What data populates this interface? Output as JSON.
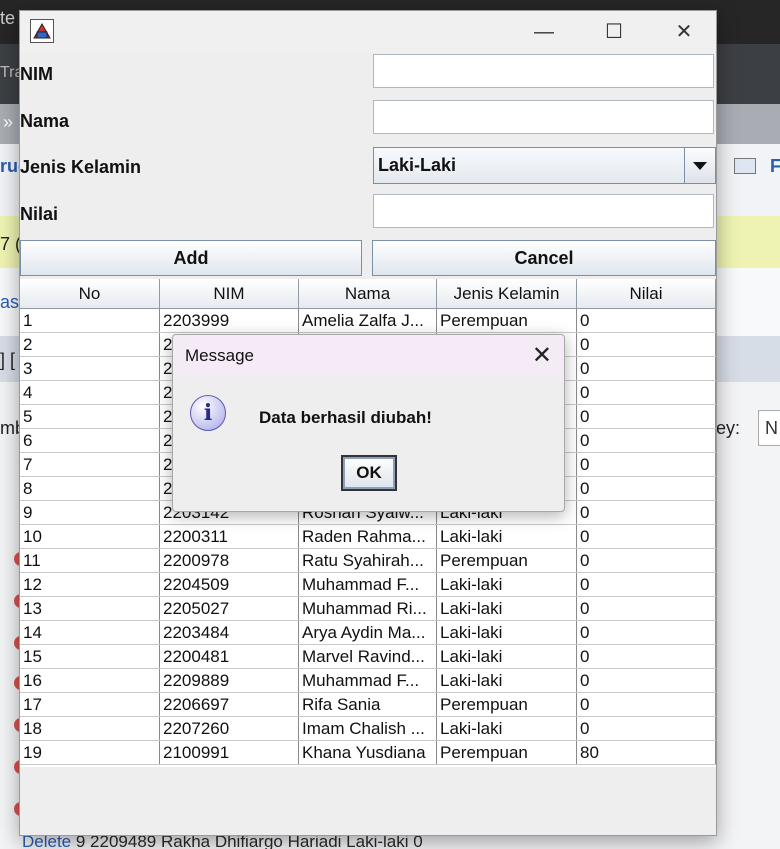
{
  "background": {
    "frag_te": "te",
    "frag_tra": "Tra",
    "frag_arrows": "»",
    "frag_uc": "ruc",
    "frag_f": "F",
    "frag_seven": "7 (",
    "frag_as": "as:",
    "frag_brackets": "] [",
    "frag_mb": "mb",
    "frag_ey": "ey:",
    "frag_n": "N",
    "row_text_delete": "Delete",
    "row_text_rest": "9     2209489  Rakha Dhifiargo Hariadi          Laki-laki          0"
  },
  "window": {
    "minimize": "—",
    "maximize": "☐",
    "close": "✕"
  },
  "form": {
    "nim_label": "NIM",
    "nama_label": "Nama",
    "jk_label": "Jenis Kelamin",
    "nilai_label": "Nilai",
    "jk_value": "Laki-Laki",
    "add_label": "Add",
    "cancel_label": "Cancel"
  },
  "table": {
    "headers": [
      "No",
      "NIM",
      "Nama",
      "Jenis Kelamin",
      "Nilai"
    ],
    "rows": [
      [
        "1",
        "2203999",
        "Amelia Zalfa J...",
        "Perempuan",
        "0"
      ],
      [
        "2",
        "2",
        "",
        "",
        "0"
      ],
      [
        "3",
        "2",
        "",
        "",
        "0"
      ],
      [
        "4",
        "2",
        "",
        "",
        "0"
      ],
      [
        "5",
        "2",
        "",
        "",
        "0"
      ],
      [
        "6",
        "2",
        "",
        "",
        "0"
      ],
      [
        "7",
        "2",
        "",
        "",
        "0"
      ],
      [
        "8",
        "2",
        "",
        "",
        "0"
      ],
      [
        "9",
        "2203142",
        "Roshan Syalw...",
        "Laki-laki",
        "0"
      ],
      [
        "10",
        "2200311",
        "Raden Rahma...",
        "Laki-laki",
        "0"
      ],
      [
        "11",
        "2200978",
        "Ratu Syahirah...",
        "Perempuan",
        "0"
      ],
      [
        "12",
        "2204509",
        "Muhammad F...",
        "Laki-laki",
        "0"
      ],
      [
        "13",
        "2205027",
        "Muhammad Ri...",
        "Laki-laki",
        "0"
      ],
      [
        "14",
        "2203484",
        "Arya Aydin Ma...",
        "Laki-laki",
        "0"
      ],
      [
        "15",
        "2200481",
        "Marvel Ravind...",
        "Laki-laki",
        "0"
      ],
      [
        "16",
        "2209889",
        "Muhammad F...",
        "Laki-laki",
        "0"
      ],
      [
        "17",
        "2206697",
        "Rifa Sania",
        "Perempuan",
        "0"
      ],
      [
        "18",
        "2207260",
        "Imam Chalish ...",
        "Laki-laki",
        "0"
      ],
      [
        "19",
        "2100991",
        "Khana Yusdiana",
        "Perempuan",
        "80"
      ]
    ]
  },
  "dialog": {
    "title": "Message",
    "close": "✕",
    "icon_glyph": "i",
    "message": "Data berhasil diubah!",
    "ok_label": "OK"
  }
}
